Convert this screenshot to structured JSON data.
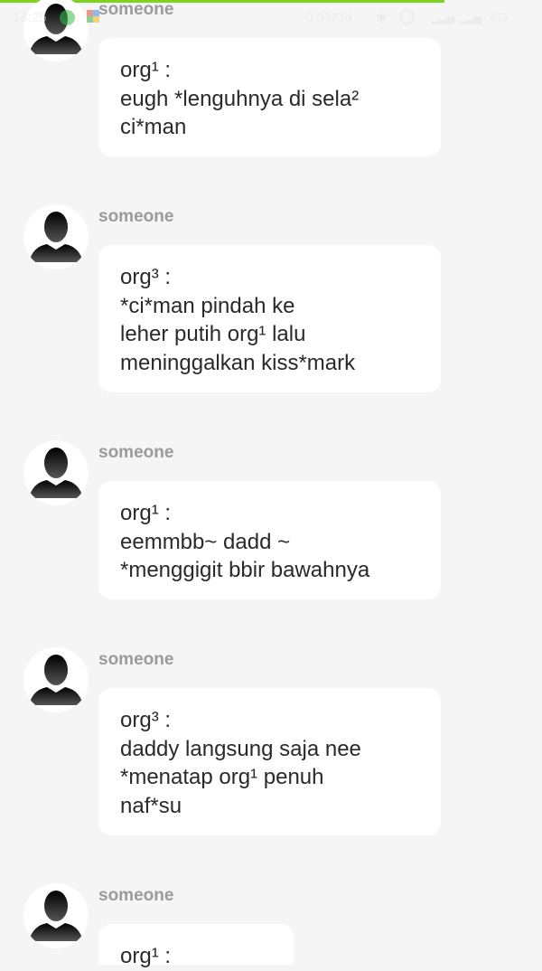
{
  "status_bar": {
    "time": "18:25",
    "speed": "0,03K/d",
    "network": "4G",
    "icons": [
      "whatsapp-icon",
      "puzzle-icon",
      "bluetooth-icon",
      "alarm-icon",
      "signal-icon",
      "signal-icon"
    ]
  },
  "colors": {
    "background": "#f5f5f5",
    "bubble": "#ffffff",
    "sender": "#9b9b9b",
    "text": "#2a2a2a",
    "load_bar": "#7ed321"
  },
  "messages": [
    {
      "sender": "someone",
      "lines": [
        "org¹ :",
        "eugh *lenguhnya di sela²",
        "ci*man"
      ]
    },
    {
      "sender": "someone",
      "lines": [
        "org³ :",
        "*ci*man pindah ke",
        "leher putih org¹ lalu",
        "meninggalkan kiss*mark"
      ]
    },
    {
      "sender": "someone",
      "lines": [
        "org¹ :",
        "eemmbb~ dadd ~",
        "*menggigit bbir bawahnya"
      ]
    },
    {
      "sender": "someone",
      "lines": [
        "org³ :",
        "daddy langsung saja nee",
        "*menatap org¹ penuh",
        "naf*su"
      ]
    },
    {
      "sender": "someone",
      "lines": [
        "org¹ :"
      ]
    }
  ]
}
